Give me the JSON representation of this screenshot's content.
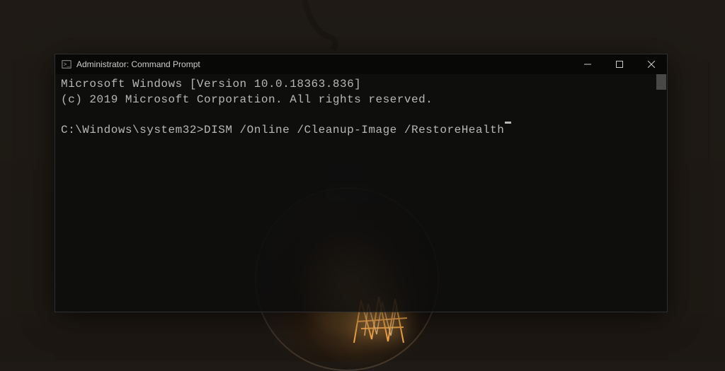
{
  "window": {
    "title": "Administrator: Command Prompt"
  },
  "terminal": {
    "line1": "Microsoft Windows [Version 10.0.18363.836]",
    "line2": "(c) 2019 Microsoft Corporation. All rights reserved.",
    "prompt": "C:\\Windows\\system32>",
    "command": "DISM /Online /Cleanup-Image /RestoreHealth"
  }
}
